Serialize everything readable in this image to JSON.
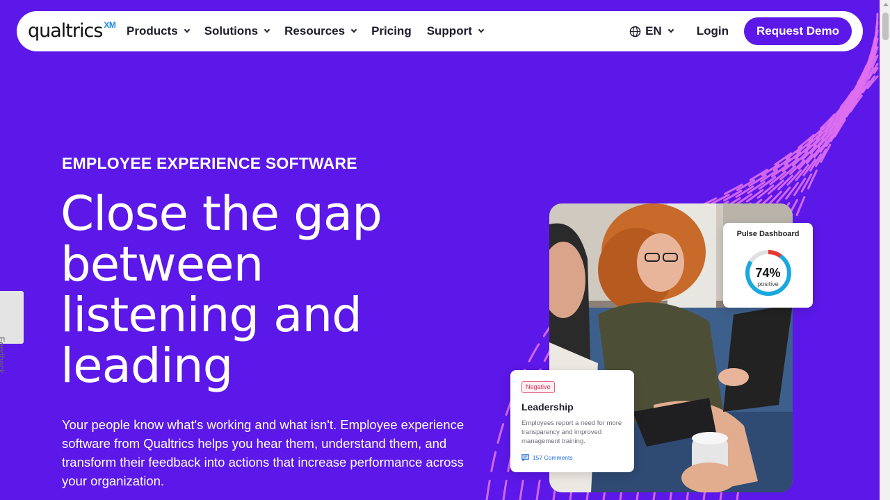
{
  "nav": {
    "logo_text": "qualtrics",
    "logo_mark": "XM",
    "items": [
      {
        "label": "Products",
        "has_dropdown": true
      },
      {
        "label": "Solutions",
        "has_dropdown": true
      },
      {
        "label": "Resources",
        "has_dropdown": true
      },
      {
        "label": "Pricing",
        "has_dropdown": false
      },
      {
        "label": "Support",
        "has_dropdown": true
      }
    ],
    "language": "EN",
    "login_label": "Login",
    "cta_label": "Request Demo"
  },
  "hero": {
    "eyebrow": "EMPLOYEE EXPERIENCE SOFTWARE",
    "headline": [
      "Close the gap",
      "between",
      "listening and",
      "leading"
    ],
    "body": "Your people know what's working and what isn't. Employee experience software from Qualtrics helps you hear them, understand them, and transform their feedback into actions that increase performance across your organization."
  },
  "feedback_tab": "Feedback",
  "pulse_card": {
    "title": "Pulse Dashboard",
    "percent_label": "74%",
    "percent_value": 0.74,
    "sub": "positive"
  },
  "leadership_card": {
    "badge": "Negative",
    "title": "Leadership",
    "text": "Employees report a need for more transparency and improved management training.",
    "comments": "157 Comments"
  },
  "colors": {
    "brand": "#5b18e8",
    "accent_lines": "#e070f0",
    "ring_positive": "#1aa8e0",
    "ring_negative": "#e53935",
    "link": "#1e6fd9"
  },
  "icons": {
    "language": "globe-icon",
    "dropdown": "chevron-down-icon",
    "comments": "comment-icon"
  }
}
